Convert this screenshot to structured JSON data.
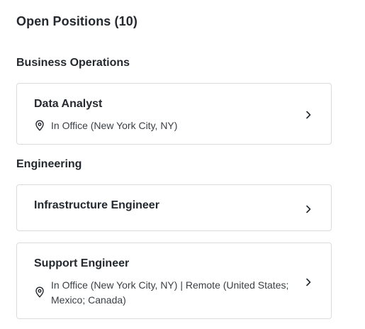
{
  "header": {
    "title": "Open Positions (10)"
  },
  "departments": [
    {
      "name": "Business Operations",
      "jobs": [
        {
          "title": "Data Analyst",
          "location": "In Office (New York City, NY)"
        }
      ]
    },
    {
      "name": "Engineering",
      "jobs": [
        {
          "title": "Infrastructure Engineer"
        },
        {
          "title": "Support Engineer",
          "location": "In Office (New York City, NY) | Remote (United States; Mexico; Canada)"
        }
      ]
    }
  ],
  "icons": {
    "location": "map-pin-icon",
    "arrow": "chevron-right-icon"
  },
  "colors": {
    "text": "#24292f",
    "border": "#d9dcdf"
  }
}
